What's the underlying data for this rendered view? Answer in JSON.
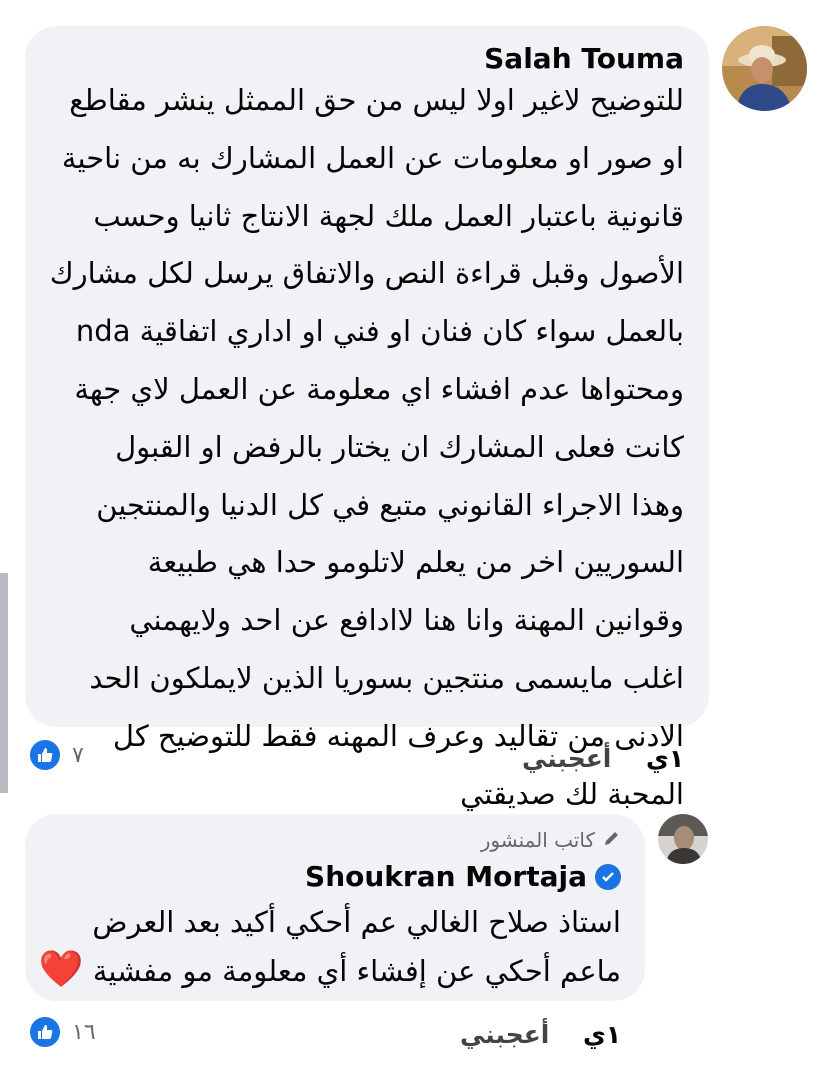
{
  "comments": [
    {
      "author": "Salah Touma",
      "lines": [
        "للتوضيح لاغير اولا ليس من حق الممثل ينشر مقاطع",
        "او صور او معلومات عن العمل المشارك به من ناحية",
        "قانونية باعتبار العمل ملك لجهة الانتاج  ثانيا وحسب",
        "الأصول وقبل قراءة النص والاتفاق يرسل لكل مشارك",
        "بالعمل سواء كان فنان او فني او اداري اتفاقية nda",
        "ومحتواها عدم افشاء اي معلومة عن العمل لاي جهة",
        "كانت   فعلى المشارك ان يختار بالرفض او القبول",
        "وهذا الاجراء القانوني متبع في كل الدنيا  والمنتجين",
        "السوريين اخر من يعلم  لاتلومو حدا هي طبيعة",
        "وقوانين المهنة وانا هنا لاادافع عن احد ولايهمني",
        "اغلب مايسمى منتجين بسوريا الذين لايملكون الحد",
        "الادنى من تقاليد وعرف المهنه  فقط للتوضيح  كل",
        "المحبة لك  صديقتي"
      ],
      "time": "١ي",
      "like_label": "أعجبني",
      "reaction_count": "٧",
      "reaction_icon": "like-icon"
    },
    {
      "author": "Shoukran Mortaja",
      "badge": "كاتب المنشور",
      "badge_icon": "pencil-icon",
      "verified_icon": "verified-check-icon",
      "lines": [
        "استاذ صلاح الغالي عم أحكي أكيد بعد العرض",
        "ماعم أحكي عن إفشاء أي معلومة مو مفشية"
      ],
      "emoji": "❤️",
      "time": "١ي",
      "like_label": "أعجبني",
      "reaction_count": "١٦",
      "reaction_icon": "like-icon"
    }
  ],
  "colors": {
    "bubble": "#f0f2f5",
    "meta": "#65676b",
    "accent": "#1b74e4",
    "heart": "#e0245e"
  }
}
